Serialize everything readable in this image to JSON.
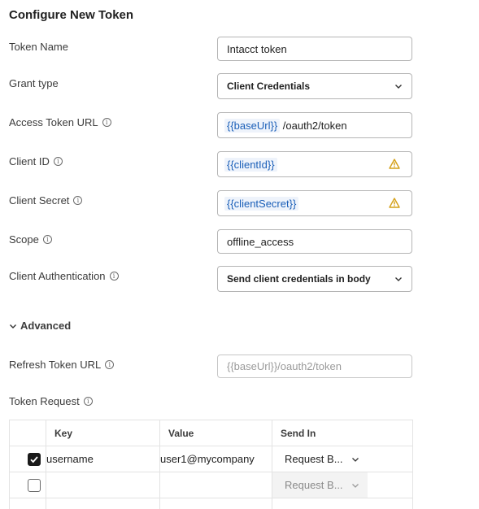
{
  "title": "Configure New Token",
  "fields": {
    "token_name": {
      "label": "Token Name",
      "value": "Intacct token"
    },
    "grant_type": {
      "label": "Grant type",
      "value": "Client Credentials"
    },
    "access_token_url": {
      "label": "Access Token URL",
      "var": "{{baseUrl}}",
      "rest": " /oauth2/token"
    },
    "client_id": {
      "label": "Client ID",
      "var": "{{clientId}}"
    },
    "client_secret": {
      "label": "Client Secret",
      "var": "{{clientSecret}}"
    },
    "scope": {
      "label": "Scope",
      "value": "offline_access"
    },
    "client_auth": {
      "label": "Client Authentication",
      "value": "Send client credentials in body"
    }
  },
  "advanced": {
    "label": "Advanced",
    "refresh_token_url": {
      "label": "Refresh Token URL",
      "placeholder": "{{baseUrl}}/oauth2/token"
    },
    "token_request": {
      "label": "Token Request",
      "headers": [
        "Key",
        "Value",
        "Send In"
      ],
      "rows": [
        {
          "checked": true,
          "key": "username",
          "value": "user1@mycompany",
          "send_in": "Request B..."
        },
        {
          "checked": false,
          "key": "",
          "value": "",
          "send_in": "Request B..."
        }
      ]
    }
  },
  "info_glyph": "i",
  "colors": {
    "variable": "#1b5fb8",
    "warning": "#d4a017"
  }
}
